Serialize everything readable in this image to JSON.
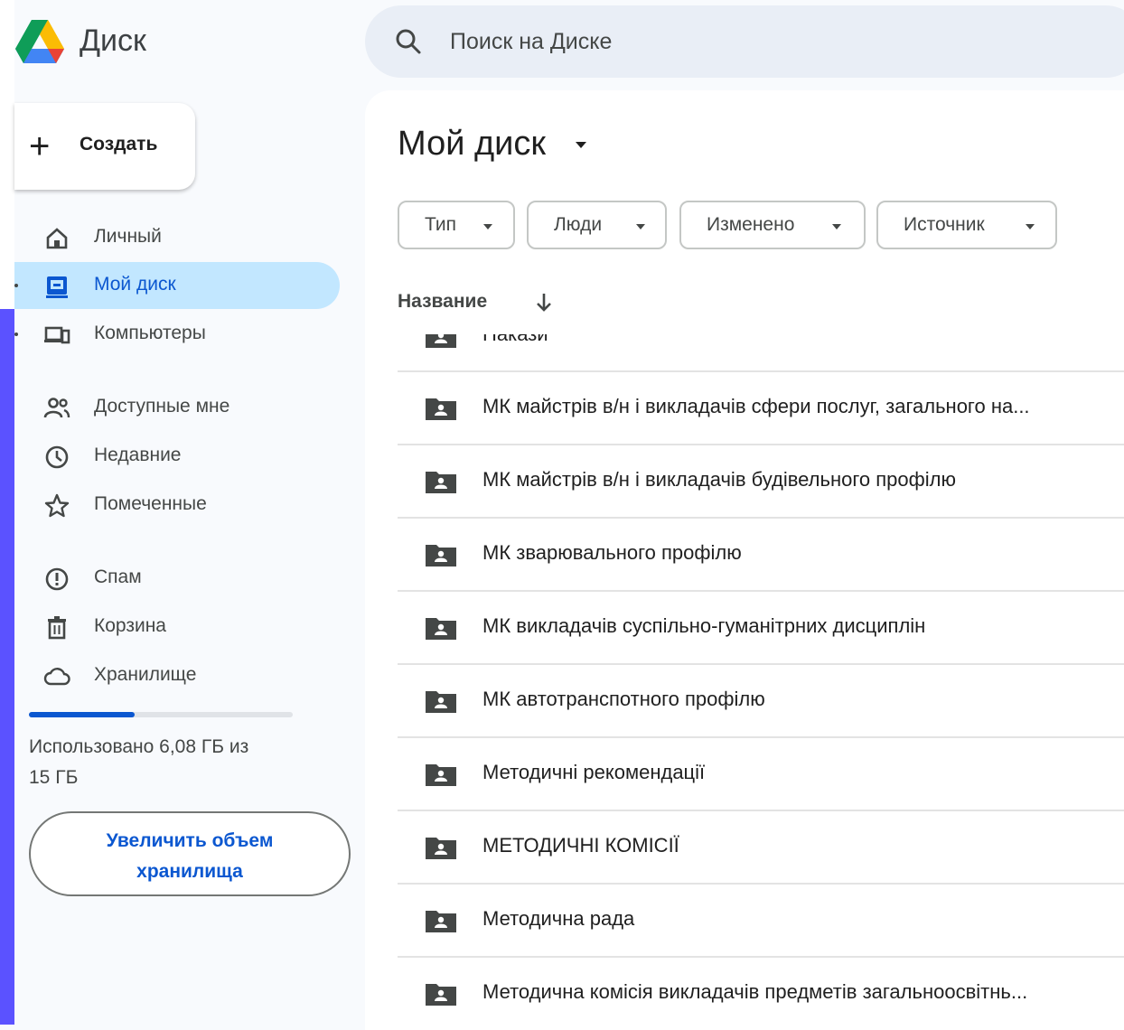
{
  "app": {
    "title": "Диск"
  },
  "search": {
    "placeholder": "Поиск на Диске"
  },
  "sidebar": {
    "create_label": "Создать",
    "items": [
      {
        "label": "Личный",
        "icon": "home-icon"
      },
      {
        "label": "Мой диск",
        "icon": "my-drive-icon",
        "active": true
      },
      {
        "label": "Компьютеры",
        "icon": "computers-icon"
      },
      {
        "label": "Доступные мне",
        "icon": "shared-icon"
      },
      {
        "label": "Недавние",
        "icon": "clock-icon"
      },
      {
        "label": "Помеченные",
        "icon": "star-icon"
      },
      {
        "label": "Спам",
        "icon": "spam-icon"
      },
      {
        "label": "Корзина",
        "icon": "trash-icon"
      },
      {
        "label": "Хранилище",
        "icon": "cloud-icon"
      }
    ],
    "storage": {
      "used_fraction": 0.4,
      "line1": "Использовано 6,08 ГБ из",
      "line2": "15 ГБ"
    },
    "upgrade": {
      "line1": "Увеличить объем",
      "line2": "хранилища"
    }
  },
  "main": {
    "title": "Мой диск",
    "filters": [
      "Тип",
      "Люди",
      "Изменено",
      "Источник"
    ],
    "column_name": "Название",
    "files": [
      "Накази",
      "МК майстрів в/н і викладачів сфери послуг, загального на...",
      "МК майстрів в/н і викладачів будівельного профілю",
      "МК зварювального профілю",
      "МК викладачів суспільно-гуманітрних дисциплін",
      "МК автотранспотного профілю",
      "Методичні рекомендації",
      "МЕТОДИЧНІ КОМІСІЇ",
      "Методична рада",
      "Методична комісія викладачів предметів загальноосвітнь..."
    ]
  },
  "colors": {
    "accent": "#0b57d0",
    "active_bg": "#c2e7ff",
    "side_bar": "#5b52ff"
  }
}
